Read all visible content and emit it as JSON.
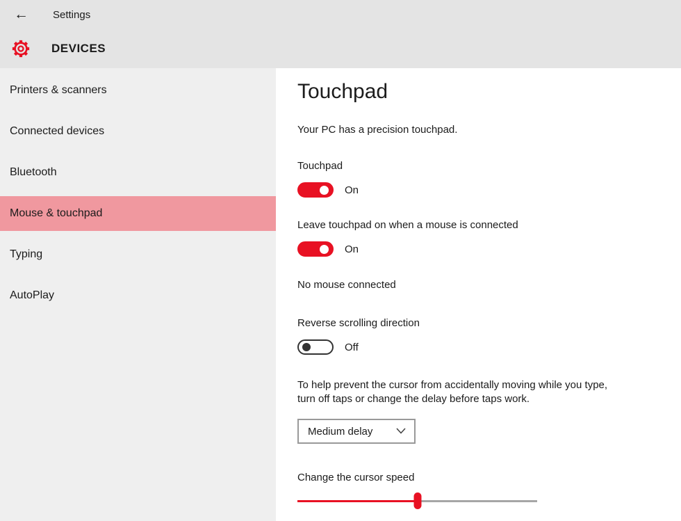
{
  "colors": {
    "accent_red": "#e81123",
    "selected_item_pink": "#f0989f",
    "header_bg": "#e4e4e4",
    "sidebar_bg": "#efefef"
  },
  "titlebar": {
    "back_icon": "←",
    "app_title": "Settings"
  },
  "header": {
    "page_title": "DEVICES"
  },
  "sidebar": {
    "items": [
      {
        "label": "Printers & scanners",
        "selected": false
      },
      {
        "label": "Connected devices",
        "selected": false
      },
      {
        "label": "Bluetooth",
        "selected": false
      },
      {
        "label": "Mouse & touchpad",
        "selected": true
      },
      {
        "label": "Typing",
        "selected": false
      },
      {
        "label": "AutoPlay",
        "selected": false
      }
    ]
  },
  "main": {
    "title": "Touchpad",
    "subtitle": "Your PC has a precision touchpad.",
    "touchpad_toggle": {
      "label": "Touchpad",
      "state_label": "On",
      "on": true
    },
    "leave_on_toggle": {
      "label": "Leave touchpad on when a mouse is connected",
      "state_label": "On",
      "on": true
    },
    "no_mouse_text": "No mouse connected",
    "reverse_toggle": {
      "label": "Reverse scrolling direction",
      "state_label": "Off",
      "on": false
    },
    "taps_help_text": "To help prevent the cursor from accidentally moving while you type, turn off taps or change the delay before taps work.",
    "delay_dropdown": {
      "selected_option": "Medium delay"
    },
    "cursor_speed": {
      "label": "Change the cursor speed",
      "value_percent": 50
    }
  }
}
